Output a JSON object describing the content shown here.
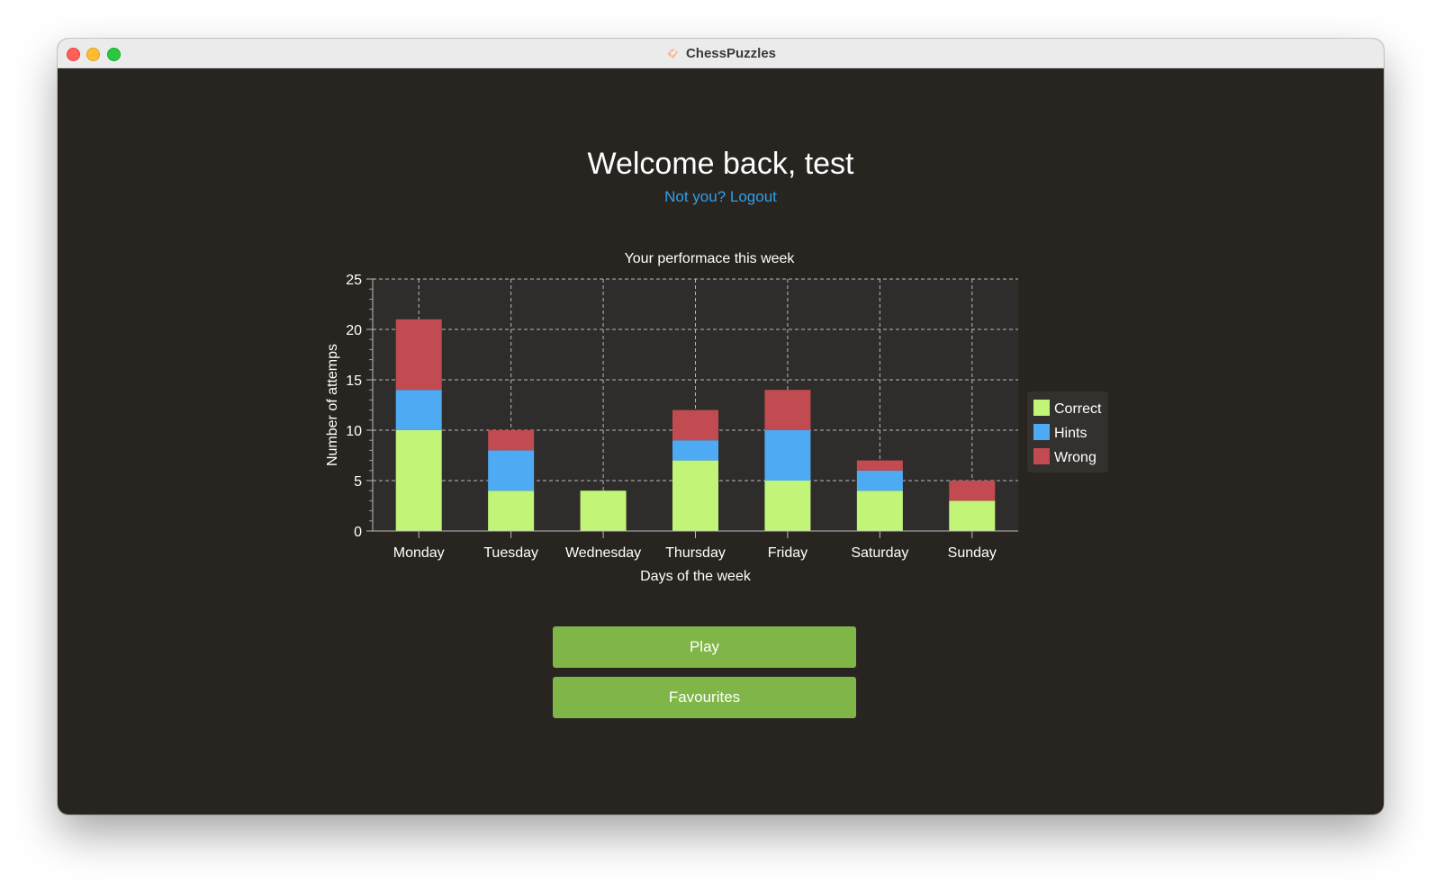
{
  "window": {
    "title": "ChessPuzzles"
  },
  "header": {
    "welcome": "Welcome back, test",
    "logout_link": "Not you? Logout"
  },
  "actions": {
    "play_label": "Play",
    "favourites_label": "Favourites"
  },
  "colors": {
    "background": "#282521",
    "plot_background": "#2f2d2c",
    "accent_button": "#7fb647",
    "link": "#2f9fe8"
  },
  "chart_data": {
    "type": "bar",
    "stacked": true,
    "title": "Your performace this week",
    "xlabel": "Days of the week",
    "ylabel": "Number of attemps",
    "categories": [
      "Monday",
      "Tuesday",
      "Wednesday",
      "Thursday",
      "Friday",
      "Saturday",
      "Sunday"
    ],
    "series": [
      {
        "name": "Correct",
        "color": "#c2f577",
        "values": [
          10,
          4,
          4,
          7,
          5,
          4,
          3
        ]
      },
      {
        "name": "Hints",
        "color": "#4eabf3",
        "values": [
          4,
          4,
          0,
          2,
          5,
          2,
          0
        ]
      },
      {
        "name": "Wrong",
        "color": "#c14b50",
        "values": [
          7,
          2,
          0,
          3,
          4,
          1,
          2
        ]
      }
    ],
    "ylim": [
      0,
      25
    ],
    "yticks": [
      0,
      5,
      10,
      15,
      20,
      25
    ],
    "grid": true,
    "legend": "right"
  }
}
